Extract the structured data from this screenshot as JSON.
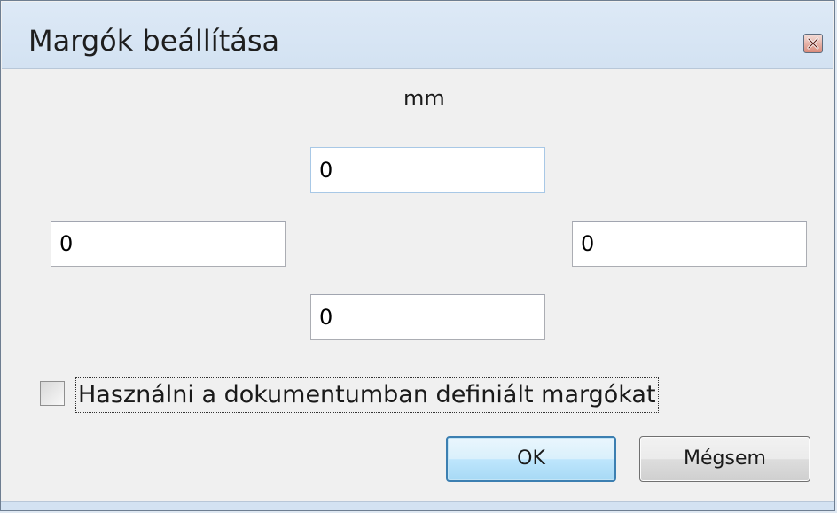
{
  "window": {
    "title": "Margók beállítása",
    "close_icon": "close-icon"
  },
  "unit_label": "mm",
  "margins": {
    "top": "0",
    "left": "0",
    "right": "0",
    "bottom": "0"
  },
  "checkbox": {
    "label": "Használni a dokumentumban definiált margókat",
    "checked": false
  },
  "buttons": {
    "ok_label": "OK",
    "cancel_label": "Mégsem"
  },
  "colors": {
    "titlebar": "#d3e2f2",
    "client": "#f0f0f0",
    "default_button_border": "#3c7fb1"
  }
}
